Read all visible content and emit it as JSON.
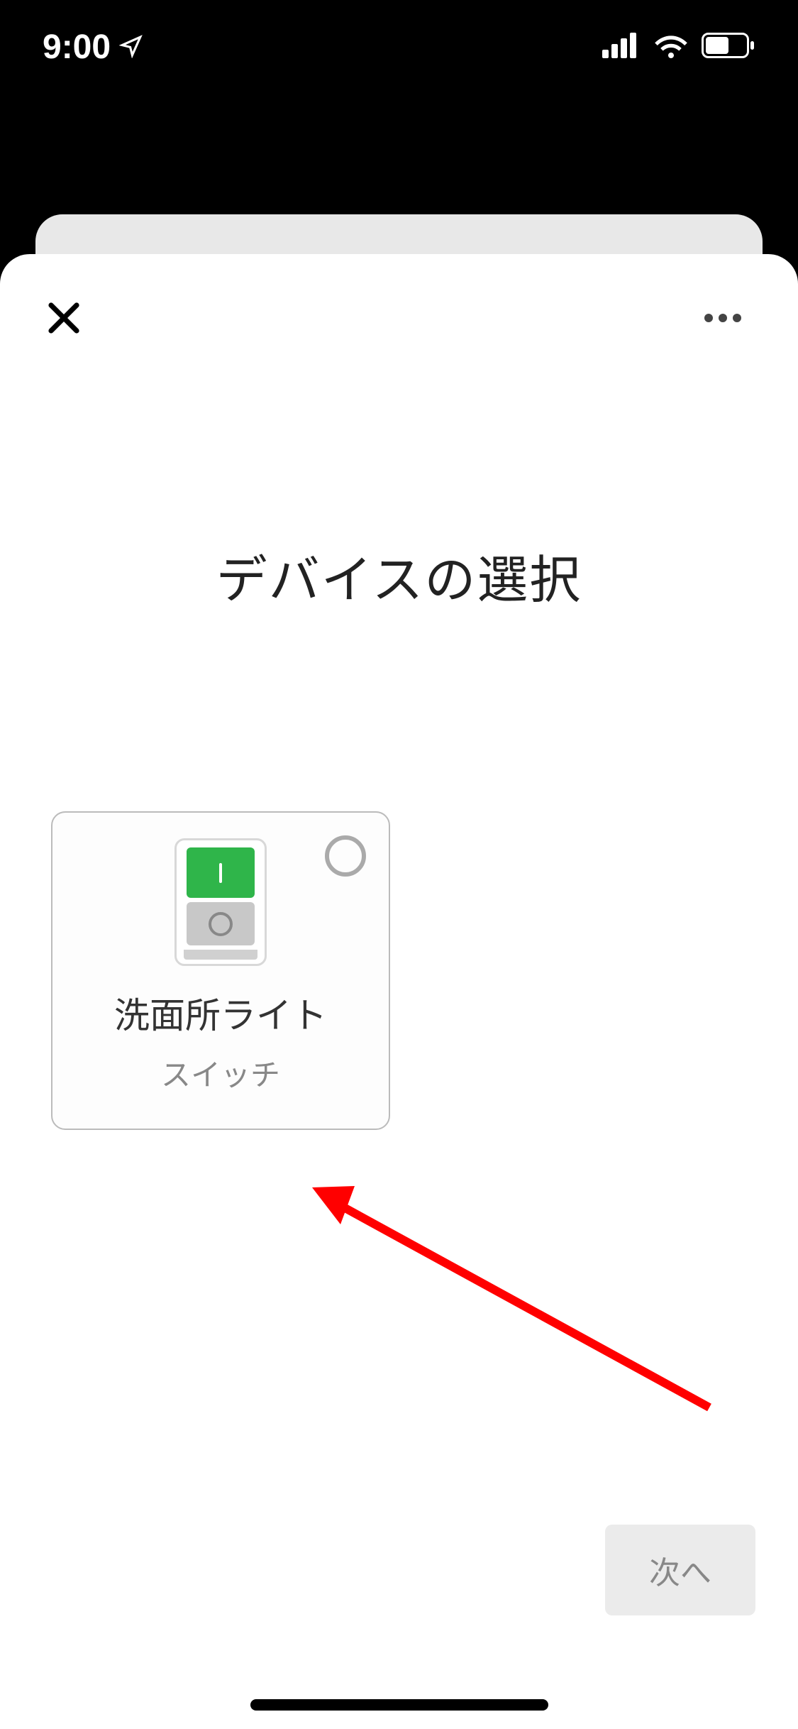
{
  "status_bar": {
    "time": "9:00"
  },
  "sheet": {
    "title": "デバイスの選択",
    "devices": [
      {
        "name": "洗面所ライト",
        "type": "スイッチ"
      }
    ],
    "next_label": "次へ"
  }
}
